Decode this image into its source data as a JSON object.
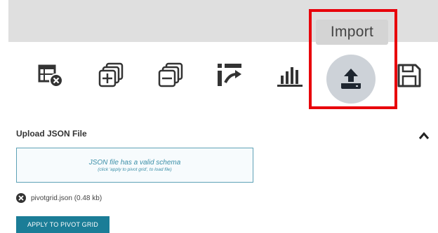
{
  "toolbar": {
    "tools": [
      {
        "icon": "clear-grid-icon"
      },
      {
        "icon": "expand-all-icon"
      },
      {
        "icon": "collapse-all-icon"
      },
      {
        "icon": "sort-icon"
      },
      {
        "icon": "chart-icon"
      },
      {
        "icon": "upload-icon"
      },
      {
        "icon": "save-icon"
      }
    ],
    "import_tooltip": "Import"
  },
  "upload": {
    "title": "Upload JSON File",
    "drop_message": "JSON file has a valid schema",
    "drop_hint": "(click 'apply to pivot grid', to load file)",
    "file_name": "pivotgrid.json (0.48 kb)",
    "apply_label": "APPLY TO PIVOT GRID"
  },
  "colors": {
    "accent": "#1b7d97",
    "highlight": "#e8000b",
    "icon": "#333333"
  }
}
